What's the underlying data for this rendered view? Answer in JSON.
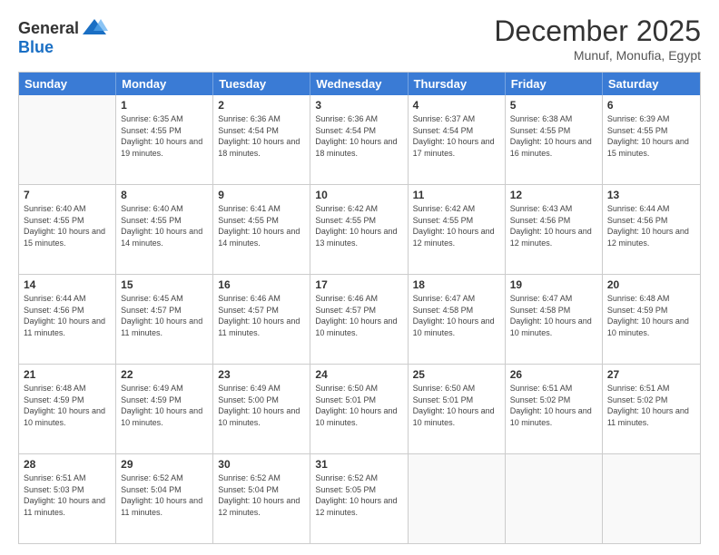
{
  "header": {
    "logo_line1": "General",
    "logo_line2": "Blue",
    "month_year": "December 2025",
    "location": "Munuf, Monufia, Egypt"
  },
  "calendar": {
    "days_of_week": [
      "Sunday",
      "Monday",
      "Tuesday",
      "Wednesday",
      "Thursday",
      "Friday",
      "Saturday"
    ],
    "rows": [
      [
        {
          "day": "",
          "empty": true
        },
        {
          "day": "1",
          "sunrise": "6:35 AM",
          "sunset": "4:55 PM",
          "daylight": "10 hours and 19 minutes."
        },
        {
          "day": "2",
          "sunrise": "6:36 AM",
          "sunset": "4:54 PM",
          "daylight": "10 hours and 18 minutes."
        },
        {
          "day": "3",
          "sunrise": "6:36 AM",
          "sunset": "4:54 PM",
          "daylight": "10 hours and 18 minutes."
        },
        {
          "day": "4",
          "sunrise": "6:37 AM",
          "sunset": "4:54 PM",
          "daylight": "10 hours and 17 minutes."
        },
        {
          "day": "5",
          "sunrise": "6:38 AM",
          "sunset": "4:55 PM",
          "daylight": "10 hours and 16 minutes."
        },
        {
          "day": "6",
          "sunrise": "6:39 AM",
          "sunset": "4:55 PM",
          "daylight": "10 hours and 15 minutes."
        }
      ],
      [
        {
          "day": "7",
          "sunrise": "6:40 AM",
          "sunset": "4:55 PM",
          "daylight": "10 hours and 15 minutes."
        },
        {
          "day": "8",
          "sunrise": "6:40 AM",
          "sunset": "4:55 PM",
          "daylight": "10 hours and 14 minutes."
        },
        {
          "day": "9",
          "sunrise": "6:41 AM",
          "sunset": "4:55 PM",
          "daylight": "10 hours and 14 minutes."
        },
        {
          "day": "10",
          "sunrise": "6:42 AM",
          "sunset": "4:55 PM",
          "daylight": "10 hours and 13 minutes."
        },
        {
          "day": "11",
          "sunrise": "6:42 AM",
          "sunset": "4:55 PM",
          "daylight": "10 hours and 12 minutes."
        },
        {
          "day": "12",
          "sunrise": "6:43 AM",
          "sunset": "4:56 PM",
          "daylight": "10 hours and 12 minutes."
        },
        {
          "day": "13",
          "sunrise": "6:44 AM",
          "sunset": "4:56 PM",
          "daylight": "10 hours and 12 minutes."
        }
      ],
      [
        {
          "day": "14",
          "sunrise": "6:44 AM",
          "sunset": "4:56 PM",
          "daylight": "10 hours and 11 minutes."
        },
        {
          "day": "15",
          "sunrise": "6:45 AM",
          "sunset": "4:57 PM",
          "daylight": "10 hours and 11 minutes."
        },
        {
          "day": "16",
          "sunrise": "6:46 AM",
          "sunset": "4:57 PM",
          "daylight": "10 hours and 11 minutes."
        },
        {
          "day": "17",
          "sunrise": "6:46 AM",
          "sunset": "4:57 PM",
          "daylight": "10 hours and 10 minutes."
        },
        {
          "day": "18",
          "sunrise": "6:47 AM",
          "sunset": "4:58 PM",
          "daylight": "10 hours and 10 minutes."
        },
        {
          "day": "19",
          "sunrise": "6:47 AM",
          "sunset": "4:58 PM",
          "daylight": "10 hours and 10 minutes."
        },
        {
          "day": "20",
          "sunrise": "6:48 AM",
          "sunset": "4:59 PM",
          "daylight": "10 hours and 10 minutes."
        }
      ],
      [
        {
          "day": "21",
          "sunrise": "6:48 AM",
          "sunset": "4:59 PM",
          "daylight": "10 hours and 10 minutes."
        },
        {
          "day": "22",
          "sunrise": "6:49 AM",
          "sunset": "4:59 PM",
          "daylight": "10 hours and 10 minutes."
        },
        {
          "day": "23",
          "sunrise": "6:49 AM",
          "sunset": "5:00 PM",
          "daylight": "10 hours and 10 minutes."
        },
        {
          "day": "24",
          "sunrise": "6:50 AM",
          "sunset": "5:01 PM",
          "daylight": "10 hours and 10 minutes."
        },
        {
          "day": "25",
          "sunrise": "6:50 AM",
          "sunset": "5:01 PM",
          "daylight": "10 hours and 10 minutes."
        },
        {
          "day": "26",
          "sunrise": "6:51 AM",
          "sunset": "5:02 PM",
          "daylight": "10 hours and 10 minutes."
        },
        {
          "day": "27",
          "sunrise": "6:51 AM",
          "sunset": "5:02 PM",
          "daylight": "10 hours and 11 minutes."
        }
      ],
      [
        {
          "day": "28",
          "sunrise": "6:51 AM",
          "sunset": "5:03 PM",
          "daylight": "10 hours and 11 minutes."
        },
        {
          "day": "29",
          "sunrise": "6:52 AM",
          "sunset": "5:04 PM",
          "daylight": "10 hours and 11 minutes."
        },
        {
          "day": "30",
          "sunrise": "6:52 AM",
          "sunset": "5:04 PM",
          "daylight": "10 hours and 12 minutes."
        },
        {
          "day": "31",
          "sunrise": "6:52 AM",
          "sunset": "5:05 PM",
          "daylight": "10 hours and 12 minutes."
        },
        {
          "day": "",
          "empty": true
        },
        {
          "day": "",
          "empty": true
        },
        {
          "day": "",
          "empty": true
        }
      ]
    ]
  }
}
